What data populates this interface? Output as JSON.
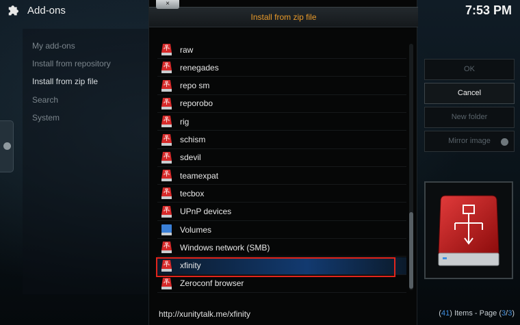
{
  "header": {
    "app_title": "Add-ons",
    "clock": "7:53 PM",
    "icon": "puzzle-icon"
  },
  "side_menu": {
    "items": [
      {
        "label": "My add-ons",
        "active": false
      },
      {
        "label": "Install from repository",
        "active": false
      },
      {
        "label": "Install from zip file",
        "active": true
      },
      {
        "label": "Search",
        "active": false
      },
      {
        "label": "System",
        "active": false
      }
    ]
  },
  "dialog": {
    "title": "Install from zip file",
    "close_label": "×",
    "title_color": "#e99a2a",
    "files": [
      {
        "label": "raw",
        "icon": "network-drive-icon"
      },
      {
        "label": "renegades",
        "icon": "network-drive-icon"
      },
      {
        "label": "repo sm",
        "icon": "network-drive-icon"
      },
      {
        "label": "reporobo",
        "icon": "network-drive-icon"
      },
      {
        "label": "rig",
        "icon": "network-drive-icon"
      },
      {
        "label": "schism",
        "icon": "network-drive-icon"
      },
      {
        "label": "sdevil",
        "icon": "network-drive-icon"
      },
      {
        "label": "teamexpat",
        "icon": "network-drive-icon"
      },
      {
        "label": "tecbox",
        "icon": "network-drive-icon"
      },
      {
        "label": "UPnP devices",
        "icon": "network-drive-icon"
      },
      {
        "label": "Volumes",
        "icon": "volume-drive-icon"
      },
      {
        "label": "Windows network (SMB)",
        "icon": "network-drive-icon"
      },
      {
        "label": "xfinity",
        "icon": "network-drive-icon",
        "focused": true
      },
      {
        "label": "Zeroconf browser",
        "icon": "network-drive-icon"
      }
    ],
    "footer_path": "http://xunitytalk.me/xfinity",
    "highlight_color": "#e3251c"
  },
  "actions": {
    "ok_label": "OK",
    "cancel_label": "Cancel",
    "new_folder_label": "New folder",
    "mirror_image_label": "Mirror image"
  },
  "status": {
    "items_count": "41",
    "items_text": ") Items - Page (",
    "page_current": "3",
    "page_sep": "/",
    "page_total": "3",
    "accent": "#3f8fe0"
  }
}
